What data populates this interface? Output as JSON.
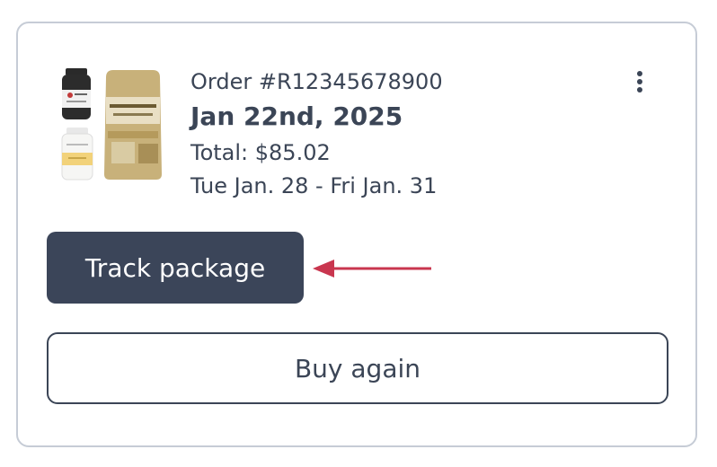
{
  "order": {
    "number": "Order #R12345678900",
    "date": "Jan 22nd, 2025",
    "total": "Total: $85.02",
    "delivery_window": "Tue Jan. 28 - Fri Jan. 31",
    "product_thumbnails": [
      "supplement-bottle-dark",
      "supplement-bottle-white",
      "supplement-pouch-gold"
    ]
  },
  "actions": {
    "track_label": "Track package",
    "buy_again_label": "Buy again"
  },
  "icons": {
    "menu": "more-vertical-icon",
    "annotation": "arrow-left-icon"
  },
  "colors": {
    "primary_button": "#3b4559",
    "text": "#3b4556",
    "card_border": "#c6ccd6",
    "annotation_arrow": "#c9364f"
  }
}
